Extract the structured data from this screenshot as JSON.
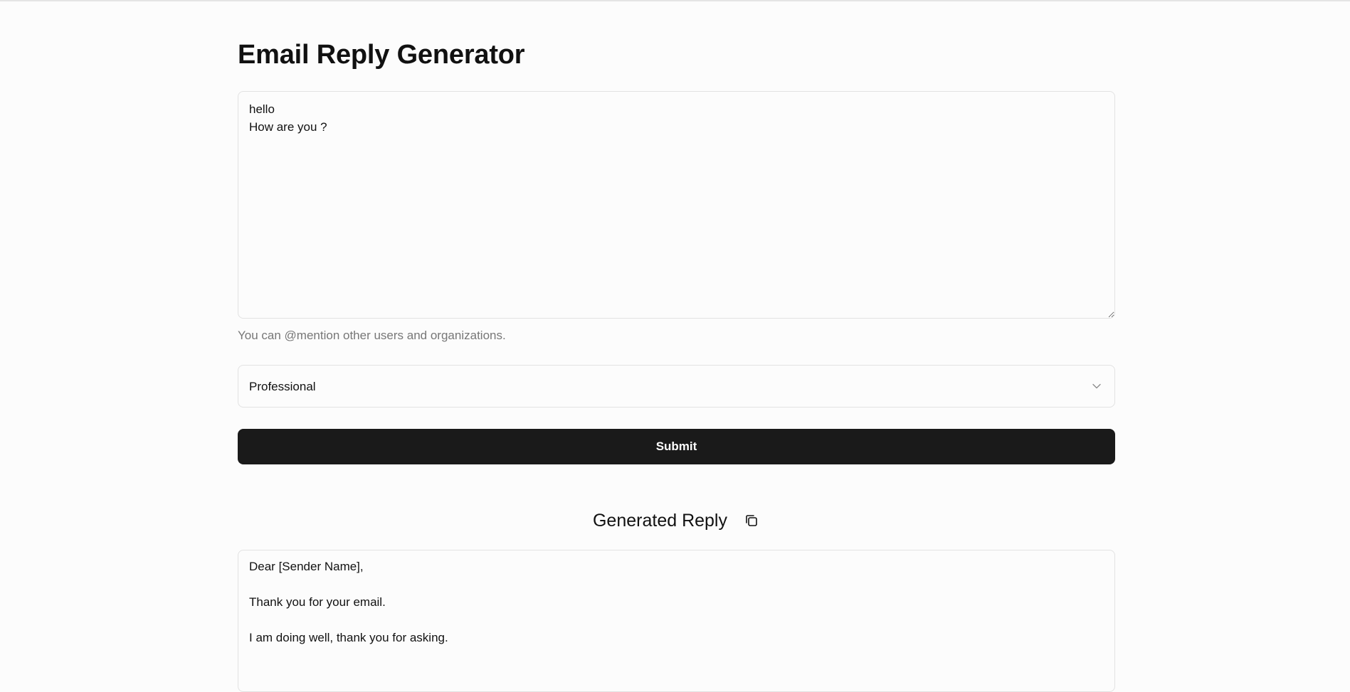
{
  "page": {
    "title": "Email Reply Generator"
  },
  "email_input": {
    "value": "hello\nHow are you ?",
    "helper_text": "You can @mention other users and organizations."
  },
  "tone_select": {
    "selected": "Professional",
    "icon": "chevron-down-icon"
  },
  "submit": {
    "label": "Submit"
  },
  "reply": {
    "title": "Generated Reply",
    "copy_icon": "copy-icon",
    "lines": {
      "greeting": "Dear [Sender Name],",
      "line1": "Thank you for your email.",
      "line2": "I am doing well, thank you for asking."
    }
  },
  "colors": {
    "background": "#fcfcfc",
    "button": "#1a1a1a",
    "border": "#e2e2e2",
    "helper_text": "#777777"
  }
}
